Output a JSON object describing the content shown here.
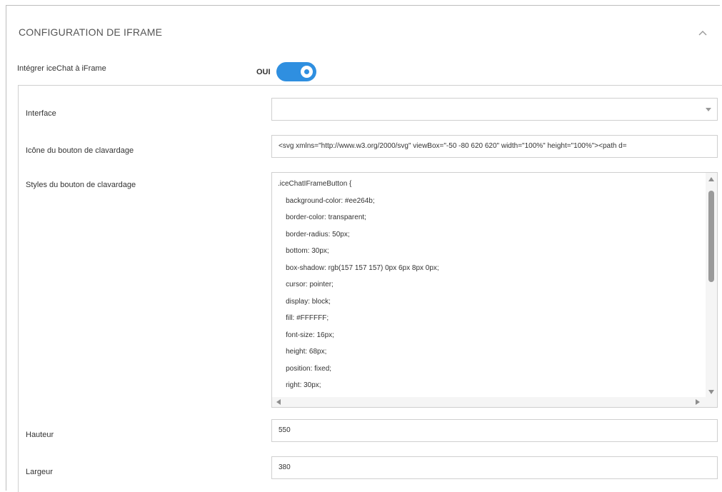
{
  "section": {
    "title": "CONFIGURATION DE IFRAME",
    "collapse_icon": "chevron-up-icon"
  },
  "embed_toggle": {
    "label": "Intégrer iceChat à iFrame",
    "state_text": "OUI",
    "checked": true,
    "color": "#2f8fe0"
  },
  "fields": {
    "interface": {
      "label": "Interface",
      "value": ""
    },
    "button_icon": {
      "label": "Icône du bouton de clavardage",
      "value": "<svg xmlns=\"http://www.w3.org/2000/svg\" viewBox=\"-50 -80 620 620\" width=\"100%\" height=\"100%\"><path d="
    },
    "button_styles": {
      "label": "Styles du bouton de clavardage",
      "lines": [
        ".iceChatIFrameButton {",
        "    background-color: #ee264b;",
        "    border-color: transparent;",
        "    border-radius: 50px;",
        "    bottom: 30px;",
        "    box-shadow: rgb(157 157 157) 0px 6px 8px 0px;",
        "    cursor: pointer;",
        "    display: block;",
        "    fill: #FFFFFF;",
        "    font-size: 16px;",
        "    height: 68px;",
        "    position: fixed;",
        "    right: 30px;"
      ]
    },
    "height": {
      "label": "Hauteur",
      "value": "550"
    },
    "width": {
      "label": "Largeur",
      "value": "380"
    }
  }
}
